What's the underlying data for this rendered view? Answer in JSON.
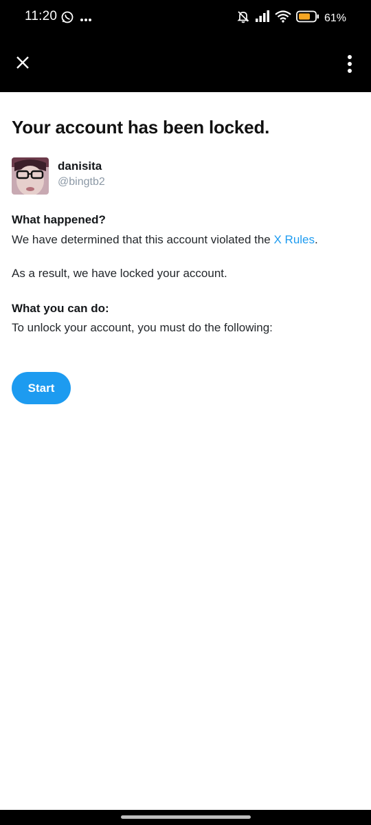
{
  "status_bar": {
    "time": "11:20",
    "battery_percent": "61%",
    "icons": [
      "whatsapp-icon",
      "more-notifications-icon",
      "bell-muted-icon",
      "signal-icon",
      "wifi-icon",
      "battery-icon"
    ]
  },
  "appbar": {
    "close_label": "X",
    "menu_icon": "more-vertical-icon"
  },
  "page": {
    "title": "Your account has been locked.",
    "user": {
      "display_name": "danisita",
      "handle": "@bingtb2"
    },
    "what_happened": {
      "heading": "What happened?",
      "text_before_link": "We have determined that this account violated the ",
      "link_text": "X Rules",
      "text_after_link": "."
    },
    "result_text": "As a result, we have locked your account.",
    "what_you_can_do": {
      "heading": "What you can do:",
      "text": "To unlock your account, you must do the following:"
    },
    "start_button": "Start"
  },
  "colors": {
    "accent": "#1d9bf0",
    "battery": "#f5a623",
    "background": "#ffffff",
    "bars": "#000000"
  }
}
